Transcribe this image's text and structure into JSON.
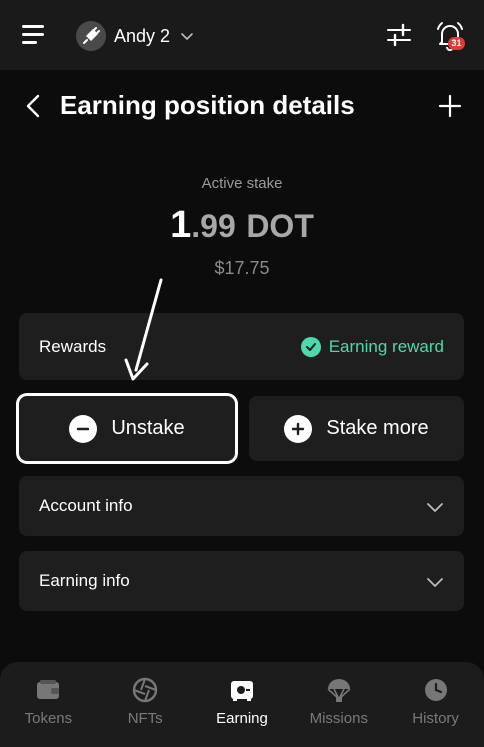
{
  "topbar": {
    "account_name": "Andy 2",
    "notification_count": "31",
    "icons": [
      "menu-icon",
      "avatar-icon",
      "chevron-down-icon",
      "sliders-icon",
      "bell-icon"
    ]
  },
  "header": {
    "title": "Earning position details"
  },
  "stake": {
    "label": "Active stake",
    "amount_int": "1",
    "amount_dec": ".99",
    "unit": "DOT",
    "fiat": "$17.75"
  },
  "rewards": {
    "label": "Rewards",
    "status": "Earning reward"
  },
  "actions": {
    "unstake_label": "Unstake",
    "stake_more_label": "Stake more"
  },
  "accordions": {
    "account_info": "Account info",
    "earning_info": "Earning info"
  },
  "nav": {
    "items": [
      {
        "label": "Tokens"
      },
      {
        "label": "NFTs"
      },
      {
        "label": "Earning"
      },
      {
        "label": "Missions"
      },
      {
        "label": "History"
      }
    ],
    "active": "Earning"
  },
  "colors": {
    "accent_green": "#4cd9ac",
    "background": "#0c0c0c",
    "card": "#1e1e1e",
    "badge_red": "#e53935"
  }
}
